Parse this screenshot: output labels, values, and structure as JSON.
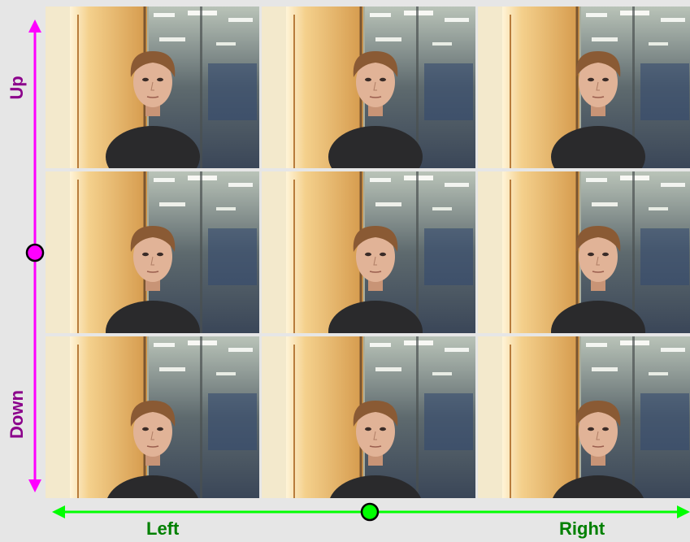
{
  "axes": {
    "vertical": {
      "top_label": "Up",
      "bottom_label": "Down",
      "color": "#ff00ff"
    },
    "horizontal": {
      "left_label": "Left",
      "right_label": "Right",
      "color": "#00ff00"
    }
  },
  "grid": {
    "rows": 3,
    "cols": 3,
    "tiles": [
      {
        "row": "up",
        "col": "left"
      },
      {
        "row": "up",
        "col": "center"
      },
      {
        "row": "up",
        "col": "right"
      },
      {
        "row": "center",
        "col": "left"
      },
      {
        "row": "center",
        "col": "center"
      },
      {
        "row": "center",
        "col": "right"
      },
      {
        "row": "down",
        "col": "left"
      },
      {
        "row": "down",
        "col": "center"
      },
      {
        "row": "down",
        "col": "right"
      }
    ]
  }
}
